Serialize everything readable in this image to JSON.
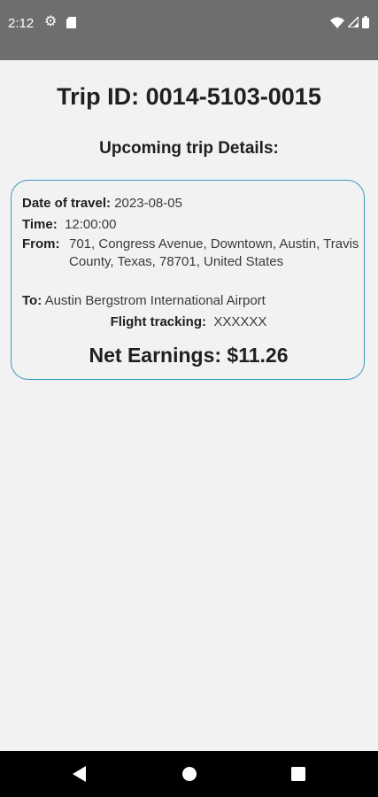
{
  "status_bar": {
    "time": "2:12",
    "icons": [
      "gear-icon",
      "sd-card-icon",
      "wifi-icon",
      "signal-icon",
      "battery-icon"
    ]
  },
  "header": {
    "trip_id": "Trip ID: 0014-5103-0015",
    "section_title": "Upcoming trip Details:"
  },
  "trip": {
    "date_label": "Date of travel:",
    "date_value": "2023-08-05",
    "time_label": "Time:",
    "time_value": "12:00:00",
    "from_label": "From:",
    "from_value": "701, Congress Avenue, Downtown, Austin, Travis County, Texas, 78701, United States",
    "to_label": "To:",
    "to_value": "Austin Bergstrom International Airport",
    "flight_label": "Flight tracking:",
    "flight_value": "XXXXXX",
    "net_earnings": "Net Earnings: $11.26"
  },
  "colors": {
    "status_bar": "#6e6e6e",
    "background": "#f2f2f2",
    "card_border": "#3a9bbb",
    "nav_bar": "#000000"
  },
  "nav_bar": {
    "icons": [
      "back-icon",
      "home-icon",
      "recents-icon"
    ]
  }
}
